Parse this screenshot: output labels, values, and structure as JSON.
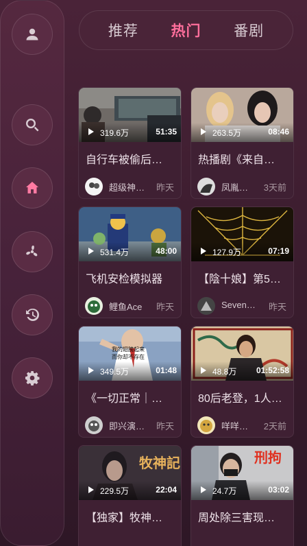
{
  "tabs": [
    {
      "label": "推荐"
    },
    {
      "label": "热门"
    },
    {
      "label": "番剧"
    }
  ],
  "sidebar": {
    "items": [
      {
        "icon": "user-icon"
      },
      {
        "icon": "search-icon"
      },
      {
        "icon": "home-icon",
        "active": true
      },
      {
        "icon": "fan-icon"
      },
      {
        "icon": "history-icon"
      },
      {
        "icon": "gear-icon"
      }
    ]
  },
  "videos": [
    {
      "views": "319.6万",
      "duration": "51:35",
      "title": "自行车被偷后…",
      "author": "超级神…",
      "time": "昨天"
    },
    {
      "views": "263.5万",
      "duration": "08:46",
      "title": "热播剧《来自…",
      "author": "凤胤…",
      "time": "3天前"
    },
    {
      "views": "531.4万",
      "duration": "48:00",
      "title": "飞机安检模拟器",
      "author": "",
      "time": ""
    },
    {
      "views": "127.9万",
      "duration": "07:19",
      "title": "【陰十娘】第5…",
      "author": "Seven…",
      "time": "昨天"
    },
    {
      "views": "349.5万",
      "duration": "01:48",
      "title": "《一切正常｜…",
      "author": "即兴演…",
      "time": "昨天"
    },
    {
      "views": "48.8万",
      "duration": "01:52:58",
      "title": "80后老登，1人…",
      "author": "咩咩…",
      "time": "2天前"
    },
    {
      "views": "229.5万",
      "duration": "22:04",
      "title": "【独家】牧神…",
      "author": "",
      "time": ""
    },
    {
      "views": "24.7万",
      "duration": "03:02",
      "title": "周处除三害现…",
      "author": "",
      "time": ""
    }
  ],
  "extra_author": {
    "author": "鲤鱼Ace",
    "time": "昨天"
  },
  "thumb_text": {
    "card5": "我的翅膀起来\n而你却不存在",
    "card7": "牧神記",
    "card8": "刑拘"
  },
  "colors": {
    "accent": "#ff6f9c",
    "background": "#3c1d2f"
  }
}
